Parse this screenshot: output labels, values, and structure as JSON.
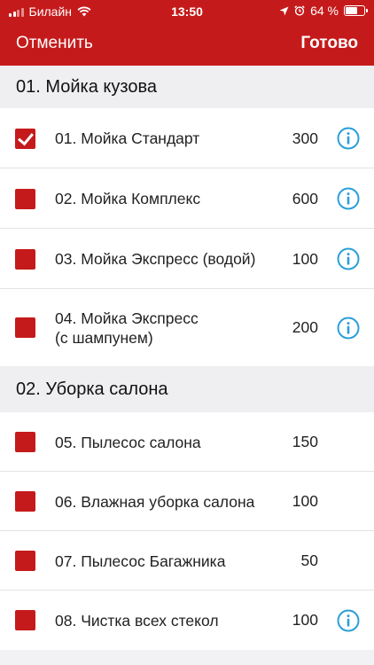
{
  "status": {
    "carrier": "Билайн",
    "time": "13:50",
    "battery": "64 %",
    "battery_level": 0.64
  },
  "nav": {
    "cancel": "Отменить",
    "done": "Готово"
  },
  "sections": [
    {
      "title": "01. Мойка кузова"
    },
    {
      "title": "02. Уборка салона"
    }
  ],
  "items": [
    {
      "name": "01. Мойка Стандарт",
      "price": "300",
      "checked": true,
      "info": true
    },
    {
      "name": "02. Мойка Комплекс",
      "price": "600",
      "checked": false,
      "info": true
    },
    {
      "name": "03. Мойка Экспресс (водой)",
      "price": "100",
      "checked": false,
      "info": true
    },
    {
      "name_line1": "04. Мойка Экспресс",
      "name_line2": "(с шампунем)",
      "price": "200",
      "checked": false,
      "info": true
    },
    {
      "name": "05. Пылесос салона",
      "price": "150",
      "checked": false,
      "info": false
    },
    {
      "name": "06. Влажная уборка салона",
      "price": "100",
      "checked": false,
      "info": false
    },
    {
      "name": "07. Пылесос Багажника",
      "price": "50",
      "checked": false,
      "info": false
    },
    {
      "name": "08. Чистка всех стекол",
      "price": "100",
      "checked": false,
      "info": true
    }
  ],
  "colors": {
    "accent": "#c51a1b",
    "info": "#2a9fd8"
  }
}
